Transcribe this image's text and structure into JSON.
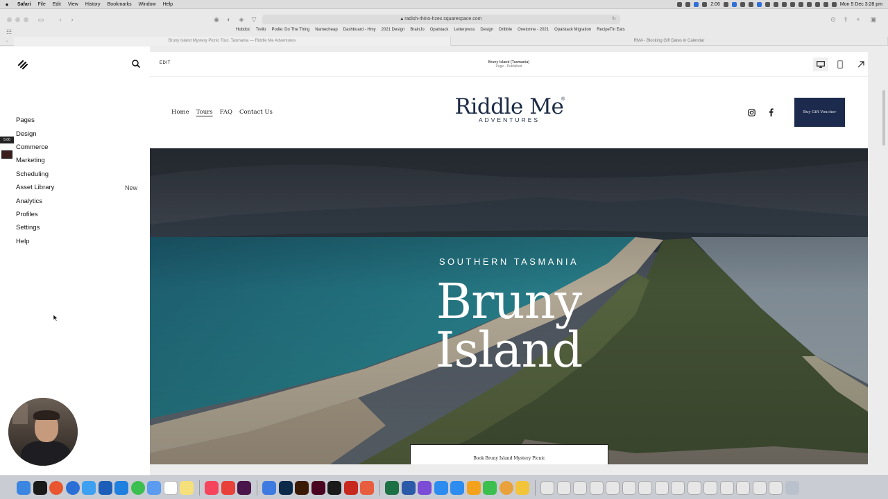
{
  "menubar": {
    "app_name": "Safari",
    "items": [
      "File",
      "Edit",
      "View",
      "History",
      "Bookmarks",
      "Window",
      "Help"
    ],
    "clock_short": "2:06",
    "datetime": "Mon 5 Dec  3:28 pm"
  },
  "browser": {
    "address": "radish-rhino-hzex.squarespace.com",
    "favorites": [
      "Hubdoc",
      "Trello",
      "Podie: Do The Thing",
      "Namecheap",
      "Dashboard - Hmy",
      "2021 Design",
      "BrainJo",
      "Opalstack",
      "Letterpress",
      "Design",
      "Dribble",
      "Onetonne - 2021",
      "Opalstack Migration",
      "RecipeTin Eats"
    ],
    "tabs": [
      {
        "title": "Bruny Island Mystery Picnic Tour, Tasmania — Riddle Me Adventures",
        "active": true
      },
      {
        "title": "RMA - Blocking Gift Dates in Calendar",
        "active": false
      }
    ]
  },
  "sidebar": {
    "items": [
      {
        "label": "Pages"
      },
      {
        "label": "Design"
      },
      {
        "label": "Commerce"
      },
      {
        "label": "Marketing"
      },
      {
        "label": "Scheduling"
      },
      {
        "label": "Asset Library",
        "badge": "New"
      },
      {
        "label": "Analytics"
      },
      {
        "label": "Profiles"
      },
      {
        "label": "Settings"
      },
      {
        "label": "Help"
      }
    ],
    "recorder_time": "5:00"
  },
  "editor": {
    "edit_label": "EDIT",
    "page_title": "Bruny Island (Tasmania)",
    "page_status": "Page · Published"
  },
  "site": {
    "nav": [
      "Home",
      "Tours",
      "FAQ",
      "Contact Us"
    ],
    "active_nav": "Tours",
    "brand_main": "Riddle Me",
    "brand_sub": "ADVENTURES",
    "brand_mark": "®",
    "cta": "Buy Gift Voucher",
    "hero": {
      "kicker": "SOUTHERN TASMANIA",
      "title_line1": "Bruny",
      "title_line2": "Island",
      "button": "Book Bruny Island Mystery Picnic"
    }
  },
  "colors": {
    "brand_navy": "#1c2b45",
    "cta_bg": "#1c2b4d",
    "sidebar_bg": "#ffffff",
    "browser_chrome": "#e9e9e9"
  }
}
